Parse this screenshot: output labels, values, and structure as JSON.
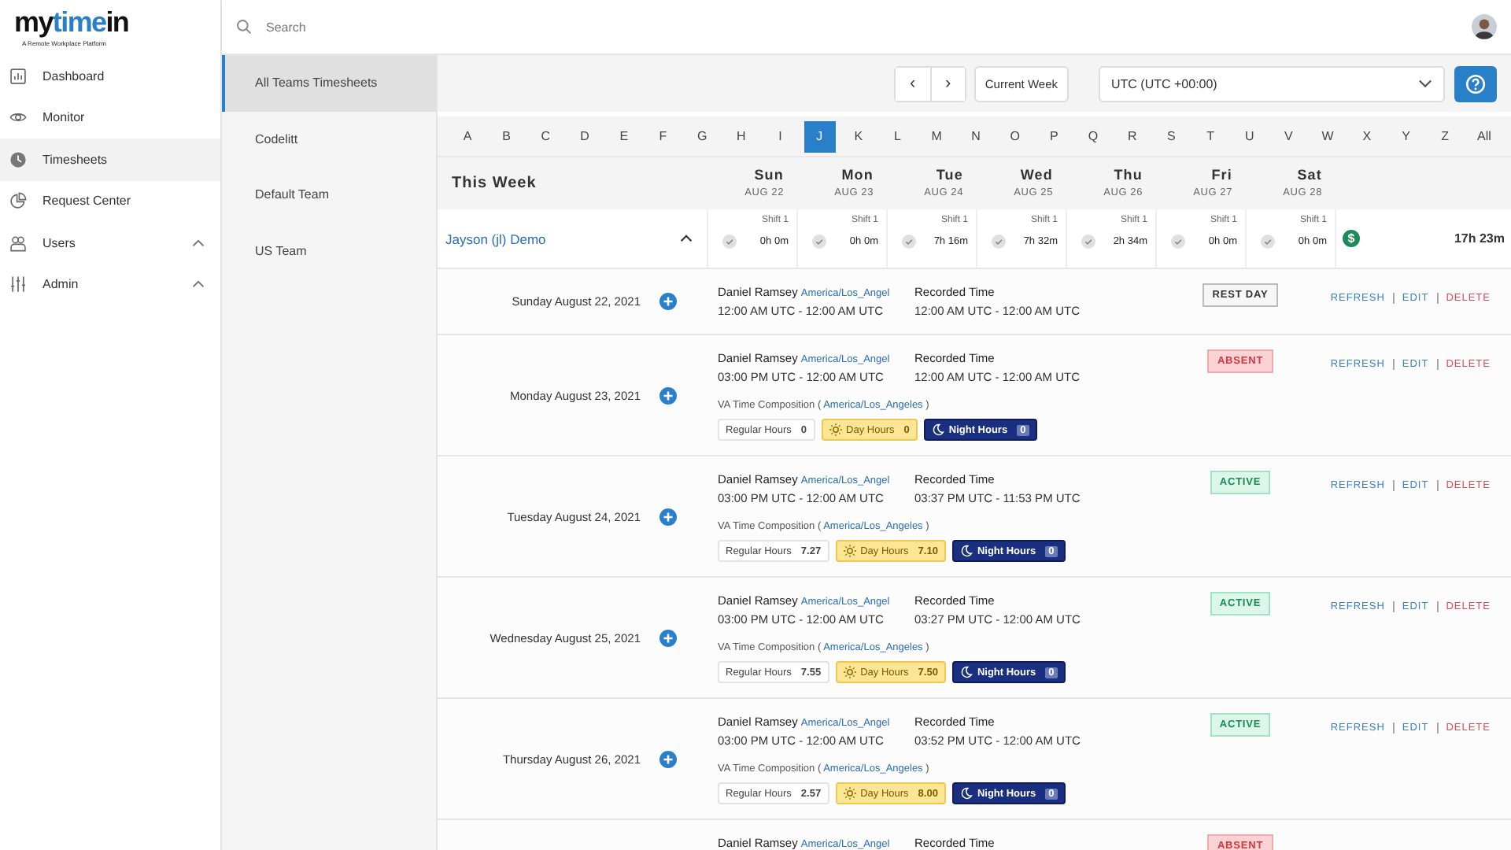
{
  "logo": {
    "parts": [
      {
        "text": "my",
        "kind": "plain"
      },
      {
        "text": "time",
        "kind": "accent"
      },
      {
        "text": "in",
        "kind": "plain"
      }
    ],
    "tagline": "A Remote Workplace Platform"
  },
  "search": {
    "placeholder": "Search"
  },
  "nav": [
    {
      "label": "Dashboard",
      "kind": "dashboard",
      "selected": false
    },
    {
      "label": "Monitor",
      "kind": "eye",
      "selected": false
    },
    {
      "label": "Timesheets",
      "kind": "clock",
      "selected": true
    },
    {
      "label": "Request Center",
      "kind": "pie",
      "selected": false
    },
    {
      "label": "Users",
      "kind": "users",
      "selected": false,
      "expanded": true
    },
    {
      "label": "Admin",
      "kind": "sliders",
      "selected": false,
      "expanded": true
    }
  ],
  "teams": [
    {
      "label": "All Teams Timesheets",
      "selected": true
    },
    {
      "label": "Codelitt",
      "selected": false
    },
    {
      "label": "Default Team",
      "selected": false
    },
    {
      "label": "US Team",
      "selected": false
    }
  ],
  "toolbar": {
    "prev": "‹",
    "next": "›",
    "current_week": "Current Week",
    "timezone": "UTC (UTC +00:00)"
  },
  "letters": [
    {
      "label": "A",
      "selected": false
    },
    {
      "label": "B",
      "selected": false
    },
    {
      "label": "C",
      "selected": false
    },
    {
      "label": "D",
      "selected": false
    },
    {
      "label": "E",
      "selected": false
    },
    {
      "label": "F",
      "selected": false
    },
    {
      "label": "G",
      "selected": false
    },
    {
      "label": "H",
      "selected": false
    },
    {
      "label": "I",
      "selected": false
    },
    {
      "label": "J",
      "selected": true
    },
    {
      "label": "K",
      "selected": false
    },
    {
      "label": "L",
      "selected": false
    },
    {
      "label": "M",
      "selected": false
    },
    {
      "label": "N",
      "selected": false
    },
    {
      "label": "O",
      "selected": false
    },
    {
      "label": "P",
      "selected": false
    },
    {
      "label": "Q",
      "selected": false
    },
    {
      "label": "R",
      "selected": false
    },
    {
      "label": "S",
      "selected": false
    },
    {
      "label": "T",
      "selected": false
    },
    {
      "label": "U",
      "selected": false
    },
    {
      "label": "V",
      "selected": false
    },
    {
      "label": "W",
      "selected": false
    },
    {
      "label": "X",
      "selected": false
    },
    {
      "label": "Y",
      "selected": false
    },
    {
      "label": "Z",
      "selected": false
    },
    {
      "label": "All",
      "selected": false
    }
  ],
  "week": {
    "title": "This Week",
    "days": [
      {
        "name": "Sun",
        "date": "AUG 22"
      },
      {
        "name": "Mon",
        "date": "AUG 23"
      },
      {
        "name": "Tue",
        "date": "AUG 24"
      },
      {
        "name": "Wed",
        "date": "AUG 25"
      },
      {
        "name": "Thu",
        "date": "AUG 26"
      },
      {
        "name": "Fri",
        "date": "AUG 27"
      },
      {
        "name": "Sat",
        "date": "AUG 28"
      }
    ]
  },
  "member": {
    "name": "Jayson (jl) Demo",
    "expanded": true,
    "pay_icon": "$",
    "total": "17h 23m",
    "shifts": [
      {
        "label": "Shift 1",
        "time": "0h 0m"
      },
      {
        "label": "Shift 1",
        "time": "0h 0m"
      },
      {
        "label": "Shift 1",
        "time": "7h 16m"
      },
      {
        "label": "Shift 1",
        "time": "7h 32m"
      },
      {
        "label": "Shift 1",
        "time": "2h 34m"
      },
      {
        "label": "Shift 1",
        "time": "0h 0m"
      },
      {
        "label": "Shift 1",
        "time": "0h 0m"
      }
    ]
  },
  "entries": [
    {
      "date": "Sunday August 22, 2021",
      "name": "Daniel Ramsey",
      "tz": "America/Los_Angel",
      "schedule": "12:00 AM UTC - 12:00 AM UTC",
      "recorded_label": "Recorded Time",
      "recorded": "12:00 AM UTC - 12:00 AM UTC",
      "status": "REST DAY",
      "kind": "rest",
      "actions": [
        {
          "label": "REFRESH",
          "kind": "refresh"
        },
        {
          "label": "EDIT",
          "kind": "edit"
        },
        {
          "label": "DELETE",
          "kind": "delete"
        }
      ]
    },
    {
      "date": "Monday August 23, 2021",
      "name": "Daniel Ramsey",
      "tz": "America/Los_Angel",
      "schedule": "03:00 PM UTC - 12:00 AM UTC",
      "recorded_label": "Recorded Time",
      "recorded": "12:00 AM UTC - 12:00 AM UTC",
      "status": "ABSENT",
      "kind": "absent",
      "actions": [
        {
          "label": "REFRESH",
          "kind": "refresh"
        },
        {
          "label": "EDIT",
          "kind": "edit"
        },
        {
          "label": "DELETE",
          "kind": "delete"
        }
      ],
      "composition": {
        "prefix": "VA Time Composition (",
        "tz": "America/Los_Angeles",
        "suffix": ")",
        "regular_label": "Regular Hours",
        "regular": "0",
        "day_label": "Day Hours",
        "day": "0",
        "night_label": "Night Hours",
        "night": "0"
      }
    },
    {
      "date": "Tuesday August 24, 2021",
      "name": "Daniel Ramsey",
      "tz": "America/Los_Angel",
      "schedule": "03:00 PM UTC - 12:00 AM UTC",
      "recorded_label": "Recorded Time",
      "recorded": "03:37 PM UTC - 11:53 PM UTC",
      "status": "ACTIVE",
      "kind": "active",
      "actions": [
        {
          "label": "REFRESH",
          "kind": "refresh"
        },
        {
          "label": "EDIT",
          "kind": "edit"
        },
        {
          "label": "DELETE",
          "kind": "delete"
        }
      ],
      "composition": {
        "prefix": "VA Time Composition (",
        "tz": "America/Los_Angeles",
        "suffix": ")",
        "regular_label": "Regular Hours",
        "regular": "7.27",
        "day_label": "Day Hours",
        "day": "7.10",
        "night_label": "Night Hours",
        "night": "0"
      }
    },
    {
      "date": "Wednesday August 25, 2021",
      "name": "Daniel Ramsey",
      "tz": "America/Los_Angel",
      "schedule": "03:00 PM UTC - 12:00 AM UTC",
      "recorded_label": "Recorded Time",
      "recorded": "03:27 PM UTC - 12:00 AM UTC",
      "status": "ACTIVE",
      "kind": "active",
      "actions": [
        {
          "label": "REFRESH",
          "kind": "refresh"
        },
        {
          "label": "EDIT",
          "kind": "edit"
        },
        {
          "label": "DELETE",
          "kind": "delete"
        }
      ],
      "composition": {
        "prefix": "VA Time Composition (",
        "tz": "America/Los_Angeles",
        "suffix": ")",
        "regular_label": "Regular Hours",
        "regular": "7.55",
        "day_label": "Day Hours",
        "day": "7.50",
        "night_label": "Night Hours",
        "night": "0"
      }
    },
    {
      "date": "Thursday August 26, 2021",
      "name": "Daniel Ramsey",
      "tz": "America/Los_Angel",
      "schedule": "03:00 PM UTC - 12:00 AM UTC",
      "recorded_label": "Recorded Time",
      "recorded": "03:52 PM UTC - 12:00 AM UTC",
      "status": "ACTIVE",
      "kind": "active",
      "actions": [
        {
          "label": "REFRESH",
          "kind": "refresh"
        },
        {
          "label": "EDIT",
          "kind": "edit"
        },
        {
          "label": "DELETE",
          "kind": "delete"
        }
      ],
      "composition": {
        "prefix": "VA Time Composition (",
        "tz": "America/Los_Angeles",
        "suffix": ")",
        "regular_label": "Regular Hours",
        "regular": "2.57",
        "day_label": "Day Hours",
        "day": "8.00",
        "night_label": "Night Hours",
        "night": "0"
      }
    },
    {
      "name": "Daniel Ramsey",
      "tz": "America/Los_Angel",
      "recorded_label": "Recorded Time",
      "status": "ABSENT",
      "kind": "absent"
    }
  ]
}
